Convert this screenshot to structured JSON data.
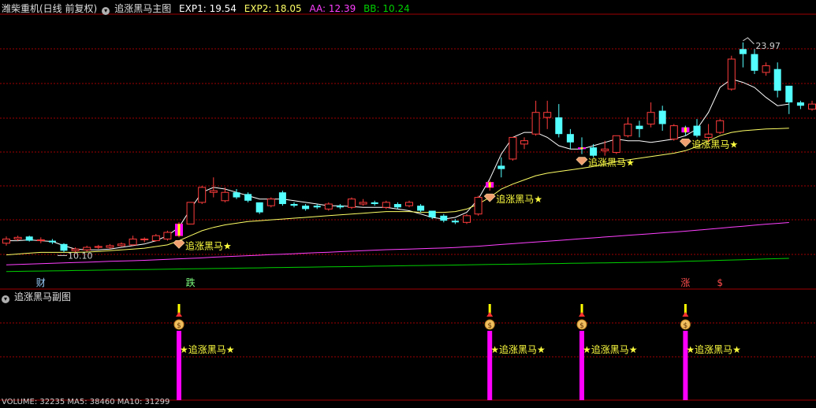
{
  "main_header": {
    "stock_name": "潍柴重机(日线 前复权)",
    "indicator": "追涨黑马主图",
    "exp1_label": "EXP1: 19.54",
    "exp2_label": "EXP2: 18.05",
    "aa_label": "AA: 12.39",
    "bb_label": "BB: 10.24"
  },
  "sub_header": {
    "indicator": "追涨黑马副图"
  },
  "bottom_text": "VOLUME: 32235 MA5: 38460 MA10: 31299",
  "colors": {
    "up": "#ff3c3c",
    "down": "#54ffff",
    "grid": "#a00000",
    "exp1": "#ffffff",
    "exp2": "#ffff66",
    "aa": "#ff40ff",
    "bb": "#00d000",
    "signal": "#ff00ff"
  },
  "chart_data": [
    {
      "type": "candlestick",
      "title": "追涨黑马主图",
      "ylim": [
        9.2,
        24.8
      ],
      "price_annotations": {
        "max": "23.97",
        "min": "10.10"
      },
      "series": [
        {
          "name": "EXP1",
          "values": [
            11.3,
            11.3,
            11.35,
            11.3,
            11.25,
            11.0,
            10.8,
            10.75,
            10.75,
            10.8,
            10.9,
            11.0,
            11.1,
            11.3,
            11.6,
            12.1,
            13.2,
            14.2,
            14.5,
            14.4,
            14.2,
            14.0,
            13.8,
            13.8,
            13.8,
            13.7,
            13.6,
            13.5,
            13.4,
            13.4,
            13.35,
            13.3,
            13.3,
            13.3,
            13.2,
            13.1,
            12.9,
            12.7,
            12.6,
            12.7,
            13.0,
            13.8,
            15.0,
            16.5,
            17.5,
            17.8,
            17.8,
            17.5,
            17.0,
            16.8,
            16.8,
            17.0,
            17.2,
            17.4,
            17.3,
            17.3,
            17.2,
            17.3,
            17.4,
            17.6,
            18.0,
            19.0,
            20.5,
            21.0,
            20.8,
            20.5,
            19.9,
            19.4,
            19.5
          ]
        },
        {
          "name": "EXP2",
          "values": [
            10.45,
            10.5,
            10.55,
            10.6,
            10.6,
            10.6,
            10.6,
            10.62,
            10.65,
            10.7,
            10.75,
            10.8,
            10.85,
            10.95,
            11.05,
            11.3,
            11.6,
            11.9,
            12.1,
            12.25,
            12.35,
            12.45,
            12.5,
            12.55,
            12.6,
            12.65,
            12.7,
            12.75,
            12.8,
            12.85,
            12.9,
            12.95,
            13.0,
            13.05,
            13.05,
            13.05,
            13.0,
            13.0,
            13.0,
            13.05,
            13.2,
            13.5,
            13.9,
            14.4,
            14.7,
            14.95,
            15.2,
            15.35,
            15.45,
            15.55,
            15.65,
            15.75,
            15.9,
            16.05,
            16.15,
            16.25,
            16.35,
            16.45,
            16.55,
            16.7,
            16.95,
            17.3,
            17.6,
            17.8,
            17.9,
            17.95,
            18.0,
            18.02,
            18.05
          ]
        },
        {
          "name": "AA",
          "values": [
            9.85,
            9.87,
            9.9,
            9.92,
            9.94,
            9.97,
            9.99,
            10.01,
            10.03,
            10.06,
            10.08,
            10.1,
            10.12,
            10.15,
            10.18,
            10.21,
            10.24,
            10.27,
            10.31,
            10.34,
            10.37,
            10.4,
            10.43,
            10.46,
            10.49,
            10.52,
            10.55,
            10.58,
            10.61,
            10.64,
            10.67,
            10.7,
            10.73,
            10.76,
            10.78,
            10.8,
            10.82,
            10.84,
            10.86,
            10.89,
            10.93,
            10.97,
            11.02,
            11.07,
            11.12,
            11.17,
            11.22,
            11.27,
            11.32,
            11.37,
            11.42,
            11.47,
            11.52,
            11.57,
            11.62,
            11.67,
            11.72,
            11.77,
            11.82,
            11.87,
            11.93,
            11.99,
            12.05,
            12.11,
            12.17,
            12.23,
            12.29,
            12.34,
            12.39
          ]
        },
        {
          "name": "BB",
          "values": [
            9.45,
            9.46,
            9.47,
            9.48,
            9.49,
            9.5,
            9.51,
            9.52,
            9.53,
            9.54,
            9.55,
            9.56,
            9.57,
            9.58,
            9.59,
            9.6,
            9.61,
            9.62,
            9.63,
            9.64,
            9.65,
            9.66,
            9.67,
            9.68,
            9.69,
            9.7,
            9.71,
            9.72,
            9.73,
            9.74,
            9.75,
            9.76,
            9.77,
            9.78,
            9.79,
            9.8,
            9.81,
            9.82,
            9.83,
            9.84,
            9.85,
            9.86,
            9.87,
            9.88,
            9.89,
            9.9,
            9.91,
            9.92,
            9.93,
            9.94,
            9.95,
            9.96,
            9.97,
            9.98,
            9.99,
            10.0,
            10.01,
            10.02,
            10.04,
            10.06,
            10.08,
            10.1,
            10.12,
            10.14,
            10.16,
            10.18,
            10.2,
            10.22,
            10.24
          ]
        }
      ],
      "candles": [
        [
          11.15,
          11.4,
          11.0,
          11.55
        ],
        [
          11.4,
          11.5,
          11.3,
          11.6
        ],
        [
          11.55,
          11.3,
          11.25,
          11.6
        ],
        [
          11.3,
          11.35,
          11.15,
          11.5
        ],
        [
          11.3,
          11.2,
          11.1,
          11.4
        ],
        [
          11.1,
          10.7,
          10.6,
          11.15
        ],
        [
          10.7,
          10.8,
          10.6,
          10.9
        ],
        [
          10.75,
          10.9,
          10.65,
          11.0
        ],
        [
          10.9,
          10.95,
          10.8,
          11.05
        ],
        [
          10.9,
          11.0,
          10.8,
          11.1
        ],
        [
          11.0,
          11.1,
          10.95,
          11.2
        ],
        [
          11.05,
          11.4,
          11.0,
          11.6
        ],
        [
          11.35,
          11.4,
          11.2,
          11.5
        ],
        [
          11.3,
          11.6,
          11.25,
          11.7
        ],
        [
          11.4,
          11.8,
          11.3,
          11.9
        ],
        [
          11.6,
          12.3,
          11.5,
          12.4
        ],
        [
          12.3,
          13.6,
          12.3,
          13.6
        ],
        [
          13.6,
          14.5,
          13.5,
          14.6
        ],
        [
          14.2,
          14.3,
          13.9,
          15.1
        ],
        [
          13.7,
          14.2,
          13.6,
          14.5
        ],
        [
          14.2,
          13.9,
          13.8,
          14.4
        ],
        [
          14.1,
          13.7,
          13.6,
          14.2
        ],
        [
          13.6,
          13.0,
          12.9,
          13.6
        ],
        [
          13.4,
          13.8,
          13.3,
          13.9
        ],
        [
          14.2,
          13.5,
          13.4,
          14.3
        ],
        [
          13.5,
          13.4,
          13.3,
          13.6
        ],
        [
          13.4,
          13.2,
          13.1,
          13.5
        ],
        [
          13.4,
          13.3,
          13.2,
          13.5
        ],
        [
          13.2,
          13.5,
          13.1,
          13.6
        ],
        [
          13.4,
          13.3,
          13.2,
          13.5
        ],
        [
          13.3,
          13.8,
          13.2,
          13.9
        ],
        [
          13.5,
          13.6,
          13.4,
          13.8
        ],
        [
          13.6,
          13.5,
          13.4,
          13.7
        ],
        [
          13.3,
          13.6,
          13.2,
          13.7
        ],
        [
          13.5,
          13.3,
          13.2,
          13.6
        ],
        [
          13.4,
          13.6,
          13.3,
          13.7
        ],
        [
          13.4,
          13.1,
          13.0,
          13.5
        ],
        [
          13.1,
          12.7,
          12.6,
          13.1
        ],
        [
          12.8,
          12.5,
          12.4,
          12.9
        ],
        [
          12.5,
          12.4,
          12.3,
          12.6
        ],
        [
          12.4,
          12.8,
          12.3,
          12.9
        ],
        [
          12.9,
          13.9,
          12.8,
          14.0
        ],
        [
          14.5,
          14.8,
          14.3,
          14.9
        ],
        [
          15.8,
          15.6,
          15.1,
          16.3
        ],
        [
          16.2,
          17.5,
          16.1,
          17.5
        ],
        [
          17.1,
          17.3,
          16.8,
          17.5
        ],
        [
          17.7,
          19.0,
          17.6,
          19.7
        ],
        [
          18.7,
          19.0,
          18.0,
          19.7
        ],
        [
          18.7,
          17.7,
          17.5,
          19.5
        ],
        [
          17.7,
          17.2,
          16.8,
          18.0
        ],
        [
          16.9,
          16.8,
          16.5,
          17.5
        ],
        [
          16.9,
          16.4,
          16.3,
          17.1
        ],
        [
          16.7,
          16.8,
          16.4,
          17.3
        ],
        [
          16.6,
          17.6,
          16.5,
          17.6
        ],
        [
          17.6,
          18.3,
          17.5,
          18.7
        ],
        [
          18.2,
          18.0,
          17.5,
          18.5
        ],
        [
          18.3,
          19.0,
          18.1,
          19.6
        ],
        [
          19.1,
          18.3,
          17.9,
          19.4
        ],
        [
          17.4,
          18.2,
          17.3,
          18.3
        ],
        [
          18.1,
          17.8,
          17.6,
          18.2
        ],
        [
          18.2,
          17.6,
          17.5,
          18.6
        ],
        [
          17.5,
          17.7,
          17.2,
          18.3
        ],
        [
          17.8,
          18.5,
          17.7,
          18.6
        ],
        [
          20.4,
          22.2,
          20.3,
          22.4
        ],
        [
          22.8,
          22.5,
          21.7,
          23.2
        ],
        [
          22.5,
          21.5,
          21.3,
          22.8
        ],
        [
          21.4,
          21.8,
          21.2,
          22.0
        ],
        [
          21.6,
          20.3,
          19.9,
          22.0
        ],
        [
          20.6,
          19.6,
          18.9,
          20.6
        ],
        [
          19.6,
          19.4,
          19.2,
          19.7
        ],
        [
          19.2,
          19.5,
          19.1,
          19.7
        ],
        [
          19.3,
          19.9,
          18.9,
          20.2
        ]
      ],
      "signals": [
        {
          "index": 15,
          "label": "追涨黑马★"
        },
        {
          "index": 42,
          "label": "追涨黑马★"
        },
        {
          "index": 50,
          "label": "追涨黑马★"
        },
        {
          "index": 59,
          "label": "追涨黑马★"
        }
      ],
      "markers": [
        {
          "index": 3,
          "label": "财",
          "color": "#9ad0ff"
        },
        {
          "index": 16,
          "label": "跌",
          "color": "#7fff7f"
        },
        {
          "index": 59,
          "label": "涨",
          "color": "#ff4c4c"
        },
        {
          "index": 62,
          "label": "$",
          "color": "#ff4c4c"
        }
      ]
    },
    {
      "type": "bar",
      "title": "追涨黑马副图",
      "signals": [
        {
          "index": 15,
          "label": "★追涨黑马★"
        },
        {
          "index": 42,
          "label": "★追涨黑马★"
        },
        {
          "index": 50,
          "label": "★追涨黑马★"
        },
        {
          "index": 59,
          "label": "★追涨黑马★"
        }
      ],
      "icon_label": "$"
    }
  ]
}
